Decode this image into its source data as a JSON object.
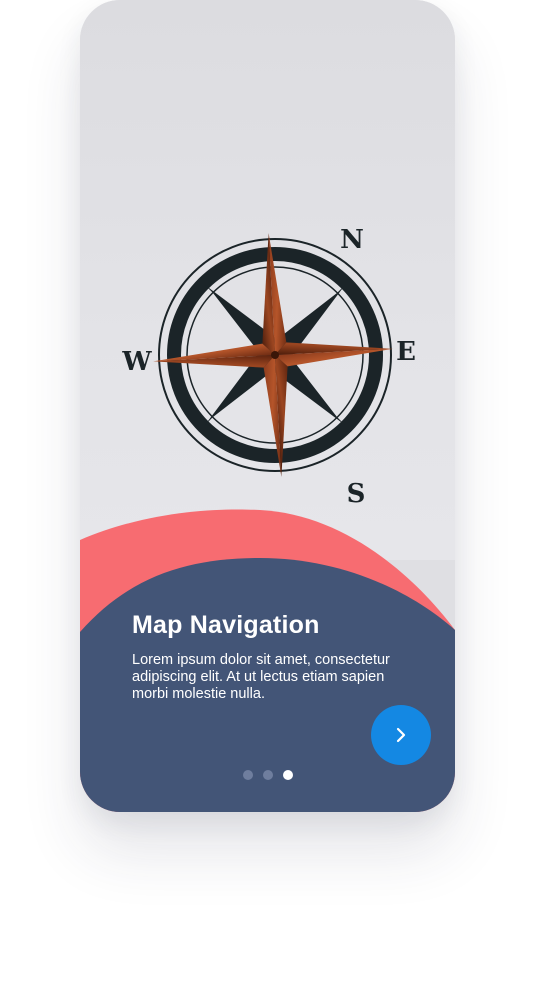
{
  "onboarding": {
    "title": "Map Navigation",
    "description": "Lorem ipsum dolor sit amet, consectetur adipiscing elit. At ut lectus etiam sapien morbi molestie nulla.",
    "next_icon": "chevron-right-icon",
    "page_indicator": {
      "total": 3,
      "active_index": 2
    }
  },
  "hero_image": {
    "subject": "compass-rose",
    "labels": {
      "north": "N",
      "south": "S",
      "east": "E",
      "west": "W"
    }
  },
  "colors": {
    "panel": "#435577",
    "wave_accent": "#f76c71",
    "button": "#1488e3",
    "dot_inactive": "#6f7e9e",
    "dot_active": "#ffffff"
  }
}
